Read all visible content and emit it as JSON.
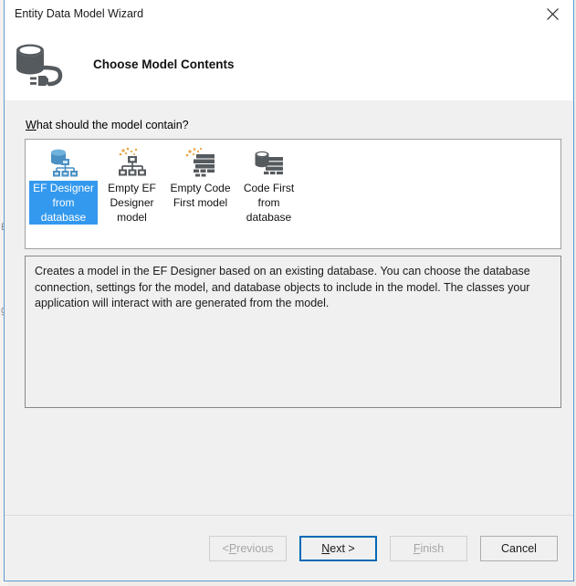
{
  "window": {
    "title": "Entity Data Model Wizard",
    "close_icon": "close-icon"
  },
  "header": {
    "icon": "database-cable-icon",
    "title": "Choose Model Contents"
  },
  "background": {
    "ghost_text_1": "Er",
    "ghost_text_2": "g"
  },
  "main": {
    "field_label_prefix": "",
    "field_label_accel": "W",
    "field_label_rest": "hat should the model contain?",
    "models": [
      {
        "label": "EF Designer from database",
        "icon": "database-hierarchy-icon",
        "selected": true
      },
      {
        "label": "Empty EF Designer model",
        "icon": "hierarchy-sparkle-icon",
        "selected": false
      },
      {
        "label": "Empty Code First model",
        "icon": "code-list-sparkle-icon",
        "selected": false
      },
      {
        "label": "Code First from database",
        "icon": "database-code-list-icon",
        "selected": false
      }
    ],
    "description": "Creates a model in the EF Designer based on an existing database. You can choose the database connection, settings for the model, and database objects to include in the model. The classes your application will interact with are generated from the model."
  },
  "footer": {
    "previous": {
      "prefix": "< ",
      "accel": "P",
      "rest": "revious",
      "enabled": false
    },
    "next": {
      "prefix": "",
      "accel": "N",
      "rest": "ext >",
      "enabled": true,
      "focused": true
    },
    "finish": {
      "prefix": "",
      "accel": "F",
      "rest": "inish",
      "enabled": false
    },
    "cancel": {
      "label": "Cancel",
      "enabled": true
    }
  },
  "colors": {
    "dialog_border": "#5b9bd5",
    "selection": "#3399ee",
    "focus_border": "#0069b4",
    "icon_blue": "#4a90c4",
    "icon_dark": "#555a5e",
    "icon_orange": "#e8a33d",
    "body_bg": "#f0f0f0"
  }
}
